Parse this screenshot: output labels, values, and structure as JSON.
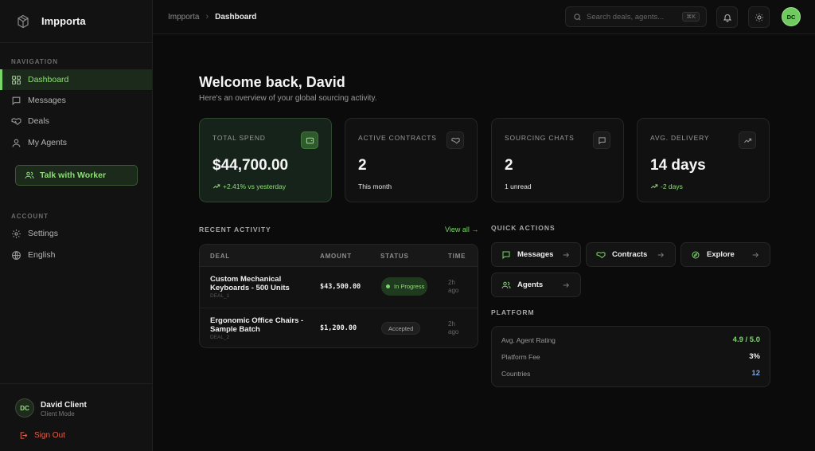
{
  "app": {
    "name": "Impporta"
  },
  "sidebar": {
    "nav_label": "NAVIGATION",
    "items": [
      {
        "label": "Dashboard",
        "icon": "grid-icon",
        "active": true
      },
      {
        "label": "Messages",
        "icon": "message-icon"
      },
      {
        "label": "Deals",
        "icon": "handshake-icon"
      },
      {
        "label": "My Agents",
        "icon": "user-icon"
      }
    ],
    "cta_label": "Talk with Worker",
    "account_label": "ACCOUNT",
    "account_items": [
      {
        "label": "Settings",
        "icon": "gear-icon"
      },
      {
        "label": "English",
        "icon": "globe-icon"
      }
    ],
    "user": {
      "initials": "DC",
      "name": "David Client",
      "mode": "Client Mode"
    },
    "signout_label": "Sign Out"
  },
  "topbar": {
    "breadcrumb": [
      "Impporta",
      "Dashboard"
    ],
    "search_placeholder": "Search deals, agents...",
    "search_shortcut": "⌘K",
    "avatar_initials": "DC"
  },
  "main": {
    "welcome": "Welcome back, David",
    "subtitle": "Here's an overview of your global sourcing activity.",
    "stats": [
      {
        "label": "TOTAL SPEND",
        "value": "$44,700.00",
        "sub": "+2.41% vs yesterday",
        "trend": "up",
        "icon": "wallet-icon"
      },
      {
        "label": "ACTIVE CONTRACTS",
        "value": "2",
        "sub": "This month",
        "icon": "handshake-icon"
      },
      {
        "label": "SOURCING CHATS",
        "value": "2",
        "sub": "1 unread",
        "icon": "message-icon"
      },
      {
        "label": "AVG. DELIVERY",
        "value": "14 days",
        "sub": "-2 days",
        "trend": "up",
        "icon": "trending-up-icon"
      }
    ],
    "recent_activity": {
      "label": "RECENT ACTIVITY",
      "view_all": "View all →",
      "columns": [
        "DEAL",
        "AMOUNT",
        "STATUS",
        "TIME"
      ],
      "rows": [
        {
          "name": "Custom Mechanical Keyboards - 500 Units",
          "id": "DEAL_1",
          "amount": "$43,500.00",
          "status": "In Progress",
          "time": "2h ago"
        },
        {
          "name": "Ergonomic Office Chairs - Sample Batch",
          "id": "DEAL_2",
          "amount": "$1,200.00",
          "status": "Accepted",
          "time": "2h ago"
        }
      ]
    },
    "quick_actions": {
      "label": "QUICK ACTIONS",
      "items": [
        {
          "label": "Messages",
          "icon": "message-icon"
        },
        {
          "label": "Contracts",
          "icon": "handshake-icon"
        },
        {
          "label": "Explore",
          "icon": "explore-icon"
        },
        {
          "label": "Agents",
          "icon": "users-icon"
        }
      ]
    },
    "platform": {
      "label": "PLATFORM",
      "rows": [
        {
          "key": "Avg. Agent Rating",
          "value": "4.9 / 5.0",
          "color": "#7bd66a"
        },
        {
          "key": "Platform Fee",
          "value": "3%",
          "color": "#f2f2f2"
        },
        {
          "key": "Countries",
          "value": "12",
          "color": "#7fa6e0"
        }
      ]
    }
  },
  "colors": {
    "accent": "#7bd66a",
    "danger": "#e0614c",
    "background": "#0b0b0b"
  }
}
